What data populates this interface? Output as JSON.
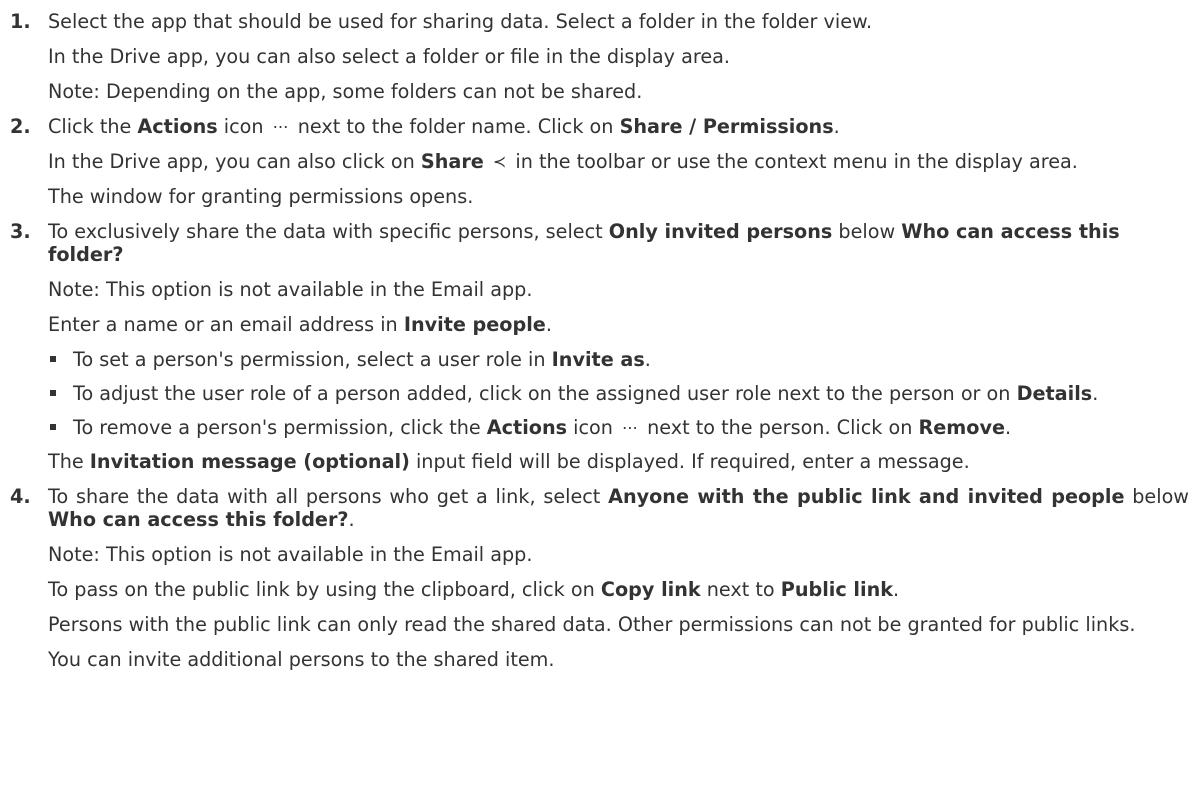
{
  "steps": [
    {
      "num": "1.",
      "p1": "Select the app that should be used for sharing data. Select a folder in the folder view.",
      "p2": "In the Drive app, you can also select a folder or file in the display area.",
      "p3": "Note: Depending on the app, some folders can not be shared."
    },
    {
      "num": "2.",
      "p1_a": "Click the ",
      "p1_b": "Actions",
      "p1_c": " icon",
      "p1_d": " next to the folder name. Click on ",
      "p1_e": "Share / Permissions",
      "p1_f": ".",
      "p2_a": "In the Drive app, you can also click on ",
      "p2_b": "Share",
      "p2_c": " in the toolbar or use the context menu in the display area.",
      "p3": "The window for granting permissions opens."
    },
    {
      "num": "3.",
      "p1_a": "To exclusively share the data with specific persons, select ",
      "p1_b": "Only invited persons",
      "p1_c": " below ",
      "p1_d": "Who can access this folder?",
      "p2": "Note: This option is not available in the Email app.",
      "p3_a": "Enter a name or an email address in ",
      "p3_b": "Invite people",
      "p3_c": ".",
      "bullets": [
        {
          "a": "To set a person's permission, select a user role in ",
          "b": "Invite as",
          "c": "."
        },
        {
          "a": "To adjust the user role of a person added, click on the assigned user role next to the person or on ",
          "b": "Details",
          "c": "."
        },
        {
          "a": "To remove a person's permission, click the ",
          "b": "Actions",
          "c": " icon",
          "d": " next to the person. Click on ",
          "e": "Remove",
          "f": "."
        }
      ],
      "p4_a": "The ",
      "p4_b": "Invitation message (optional)",
      "p4_c": " input field will be displayed. If required, enter a message."
    },
    {
      "num": "4.",
      "p1_a": "To share the data with all persons who get a link, select ",
      "p1_b": "Anyone with the public link and invited people",
      "p1_c": " below ",
      "p1_d": "Who can access this folder?",
      "p1_e": ".",
      "p2": "Note: This option is not available in the Email app.",
      "p3_a": "To pass on the public link by using the clipboard, click on ",
      "p3_b": "Copy link",
      "p3_c": " next to ",
      "p3_d": "Public link",
      "p3_e": ".",
      "p4": "Persons with the public link can only read the shared data. Other permissions can not be granted for public links.",
      "p5": "You can invite additional persons to the shared item."
    }
  ],
  "icons": {
    "actions": "⋯",
    "share": "≺"
  }
}
